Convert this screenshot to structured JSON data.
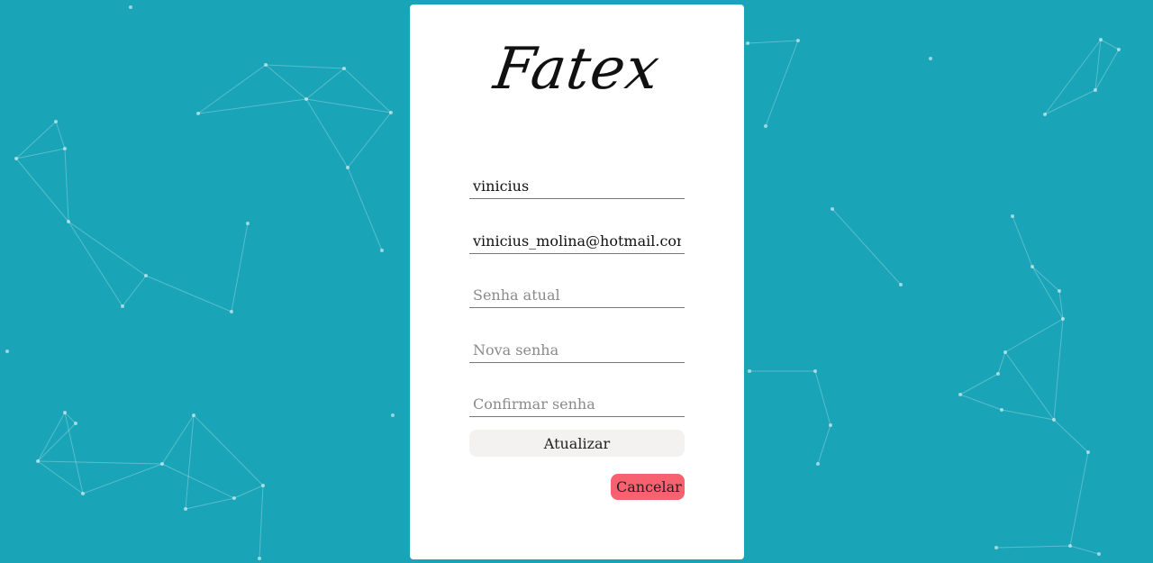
{
  "brand": {
    "logo_text": "Fatex"
  },
  "form": {
    "username": {
      "value": "vinicius"
    },
    "email": {
      "value": "vinicius_molina@hotmail.com"
    },
    "current_password": {
      "placeholder": "Senha atual"
    },
    "new_password": {
      "placeholder": "Nova senha"
    },
    "confirm_password": {
      "placeholder": "Confirmar senha"
    },
    "update_label": "Atualizar",
    "cancel_label": "Cancelar"
  },
  "colors": {
    "background": "#19a4b8",
    "card": "#ffffff",
    "update_button": "#f3f2f0",
    "cancel_button": "#f8616f"
  }
}
